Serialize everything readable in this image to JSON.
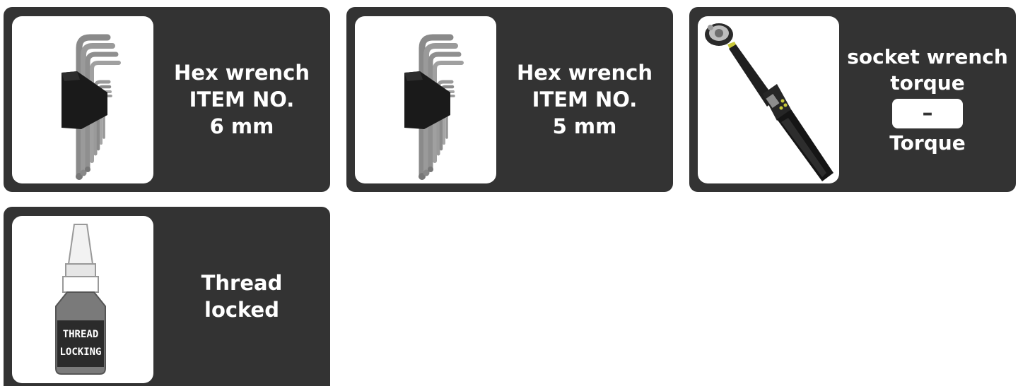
{
  "cards": [
    {
      "line1": "Hex wrench",
      "line2": "ITEM NO.",
      "line3": "6 mm",
      "icon": "hex-key-set-icon"
    },
    {
      "line1": "Hex wrench",
      "line2": "ITEM NO.",
      "line3": "5 mm",
      "icon": "hex-key-set-icon"
    },
    {
      "line1": "socket wrench",
      "line2": "torque",
      "value": "–",
      "line3": "Torque",
      "icon": "torque-wrench-icon"
    },
    {
      "line1": "Thread",
      "line2": "locked",
      "icon": "thread-lock-bottle-icon",
      "bottle_text_1": "THREAD",
      "bottle_text_2": "LOCKING"
    }
  ],
  "colors": {
    "card_bg": "#333333",
    "thumb_bg": "#ffffff",
    "text": "#ffffff"
  }
}
